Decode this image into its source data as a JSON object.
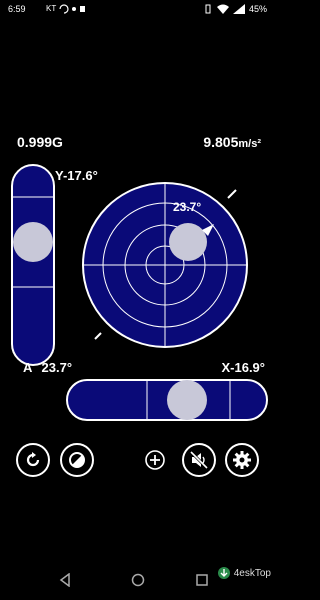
{
  "status_bar": {
    "time": "6:59",
    "notif_text": "KT",
    "battery": "45%"
  },
  "readouts": {
    "g_force": "0.999G",
    "acceleration": "9.805",
    "acceleration_unit": "m/s²",
    "y_angle": "Y-17.6°",
    "x_angle": "X-16.9°",
    "a_label": "A",
    "a_angle": "23.7°",
    "bubble_angle": "23.7°"
  },
  "controls": [
    {
      "name": "calibrate-button",
      "icon": "rotate-icon"
    },
    {
      "name": "theme-button",
      "icon": "contrast-icon"
    },
    {
      "name": "add-button",
      "icon": "plus-icon"
    },
    {
      "name": "sound-button",
      "icon": "mute-icon"
    },
    {
      "name": "settings-button",
      "icon": "gear-icon"
    }
  ],
  "nav": [
    "back-icon",
    "home-icon",
    "recents-icon"
  ],
  "watermark": "4eskTop",
  "colors": {
    "level_blue": "#0a0a78",
    "bubble": "#c8c8d8",
    "line": "#ffffff"
  }
}
